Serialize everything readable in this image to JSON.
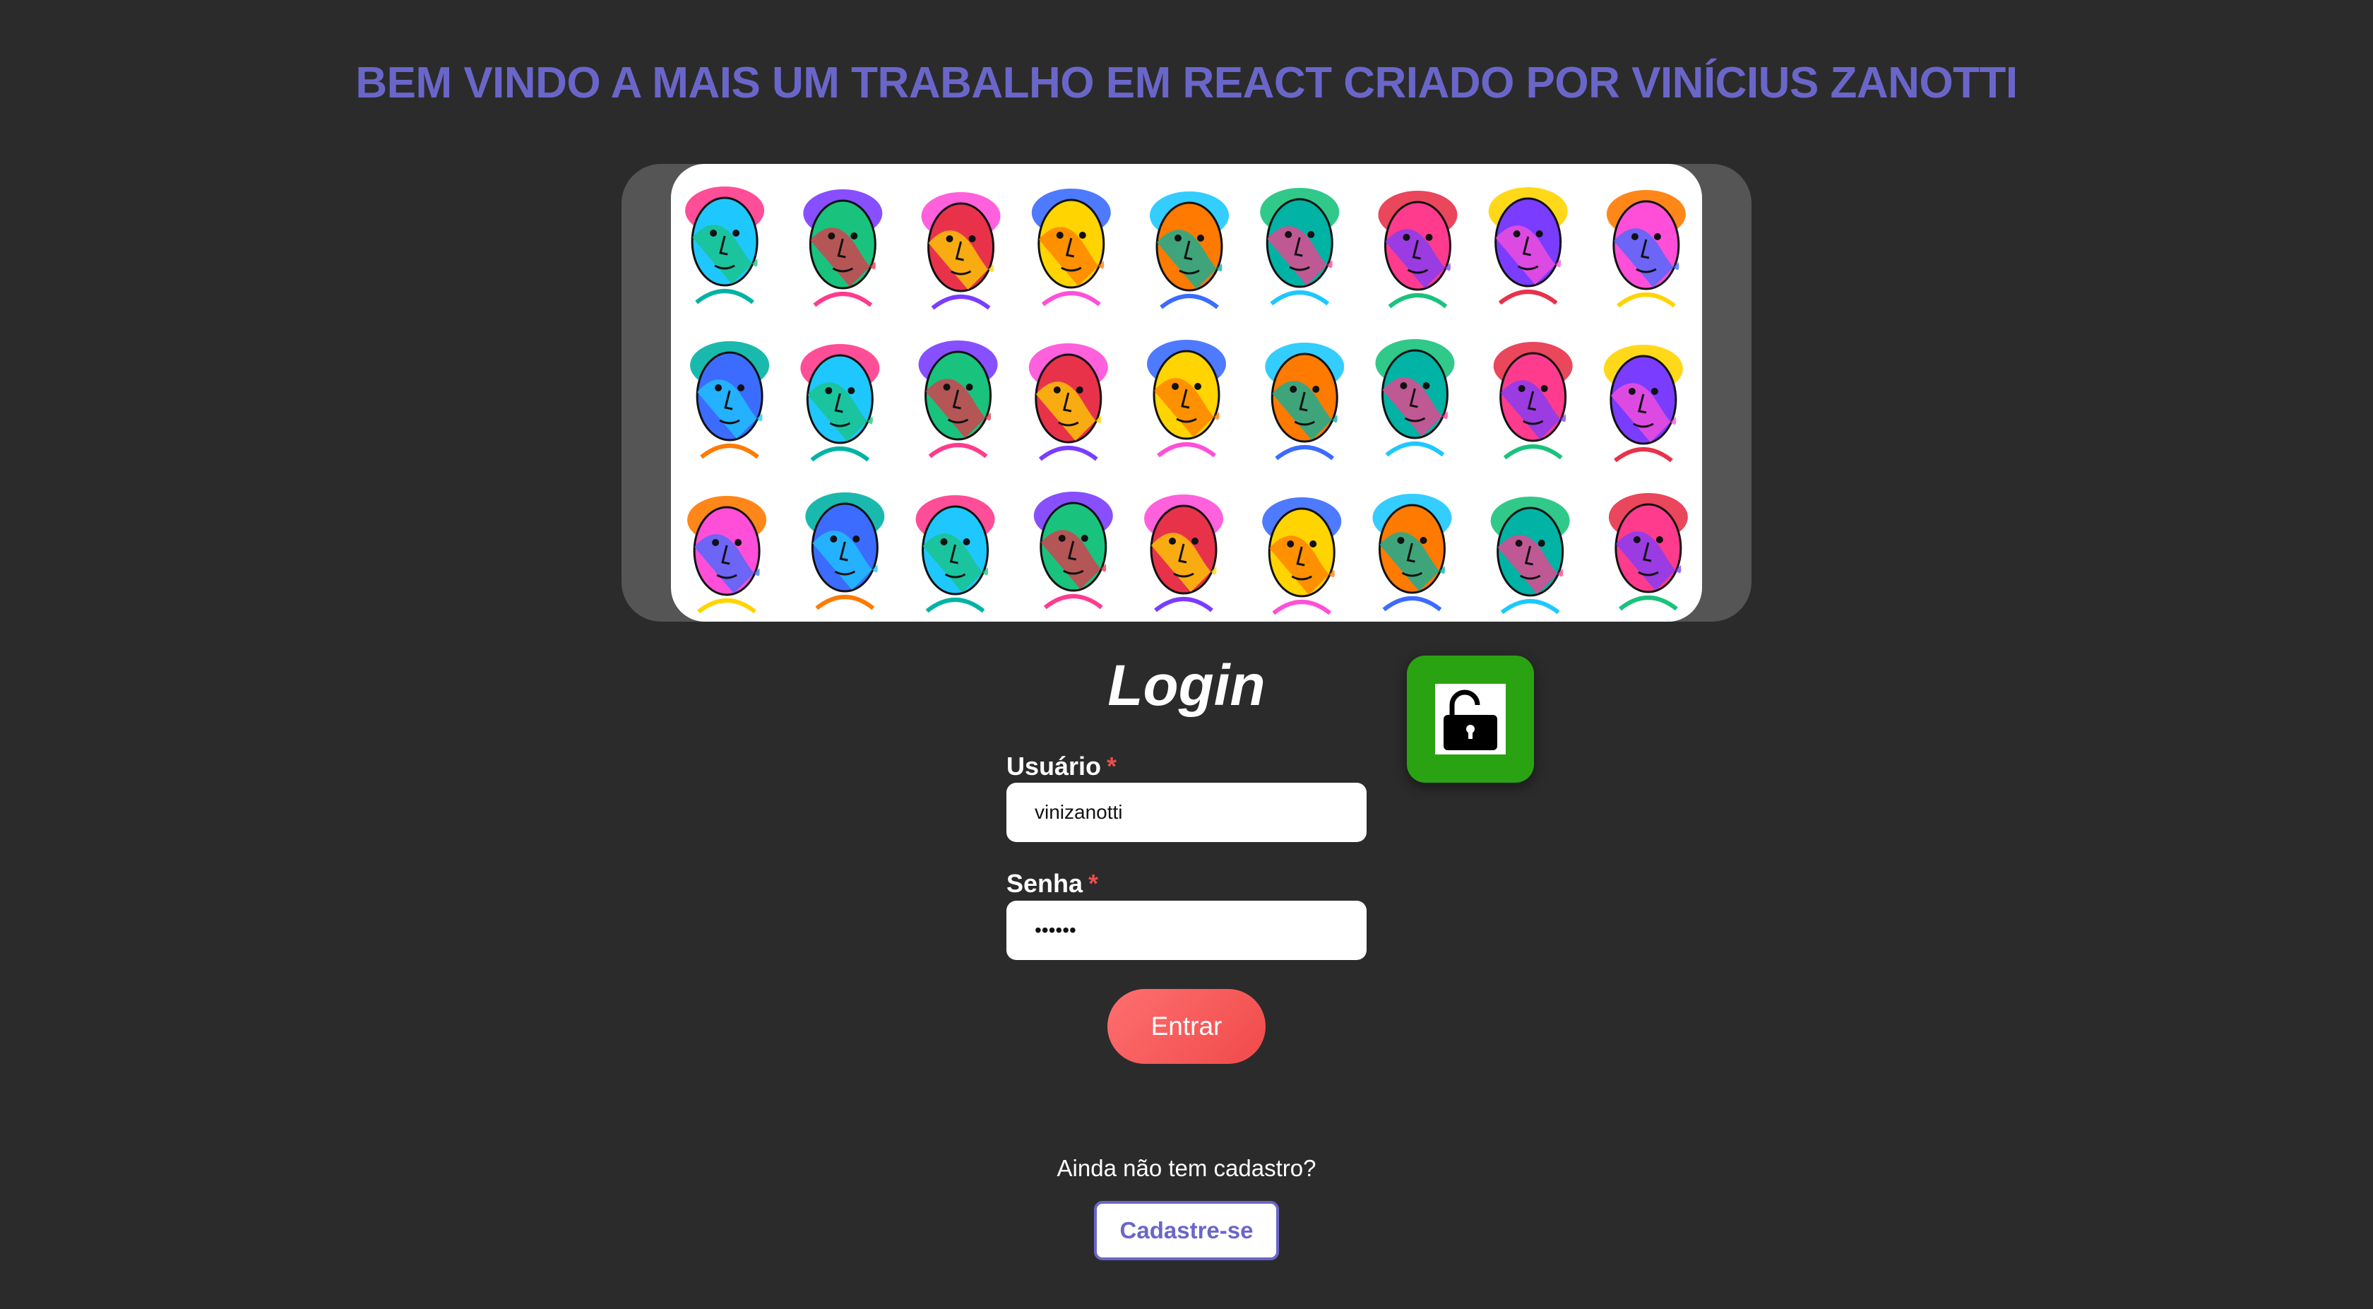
{
  "header": {
    "title": "BEM VINDO A MAIS UM TRABALHO EM REACT CRIADO POR VINÍCIUS ZANOTTI"
  },
  "banner": {
    "image": "colorful-line-art-faces-illustration"
  },
  "login": {
    "title": "Login",
    "lock_icon": "unlocked-padlock-icon",
    "lock_badge_color": "#2aa312",
    "username": {
      "label": "Usuário",
      "required_mark": "*",
      "value": "vinizanotti"
    },
    "password": {
      "label": "Senha",
      "required_mark": "*",
      "value": "••••••"
    },
    "submit_label": "Entrar"
  },
  "signup": {
    "prompt": "Ainda não tem cadastro?",
    "button_label": "Cadastre-se"
  },
  "colors": {
    "background": "#2b2b2b",
    "accent": "#6a66c9",
    "button": "#f25555",
    "required": "#ea4d4d"
  }
}
